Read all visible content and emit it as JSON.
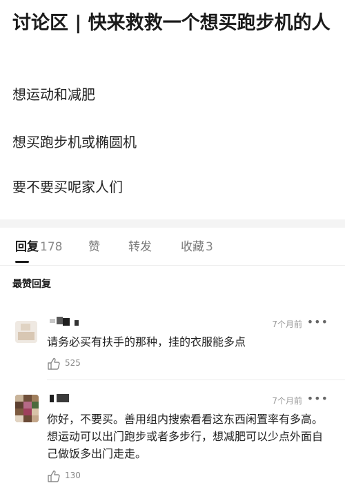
{
  "post": {
    "title": "讨论区 | 快来救救一个想买跑步机的人",
    "lines": [
      "想运动和减肥",
      "想买跑步机或椭圆机",
      "要不要买呢家人们"
    ]
  },
  "tabs": [
    {
      "label": "回复",
      "count": "178",
      "active": true
    },
    {
      "label": "赞",
      "count": "",
      "active": false
    },
    {
      "label": "转发",
      "count": "",
      "active": false
    },
    {
      "label": "收藏",
      "count": "3",
      "active": false
    }
  ],
  "section_label": "最赞回复",
  "comments": [
    {
      "time": "7个月前",
      "more": "•••",
      "text": "请务必买有扶手的那种，挂的衣服能多点",
      "likes": "525",
      "like_icon": "thumbs-up-icon",
      "more_icon": "more-icon"
    },
    {
      "time": "7个月前",
      "more": "•••",
      "text": "你好，不要买。善用组内搜索看看这东西闲置率有多高。想运动可以出门跑步或者多步行，想减肥可以少点外面自己做饭多出门走走。",
      "likes": "130",
      "like_icon": "thumbs-up-icon",
      "more_icon": "more-icon"
    }
  ],
  "colors": {
    "text": "#222222",
    "muted": "#888888",
    "divider": "#ececec",
    "band": "#f4f4f4"
  }
}
